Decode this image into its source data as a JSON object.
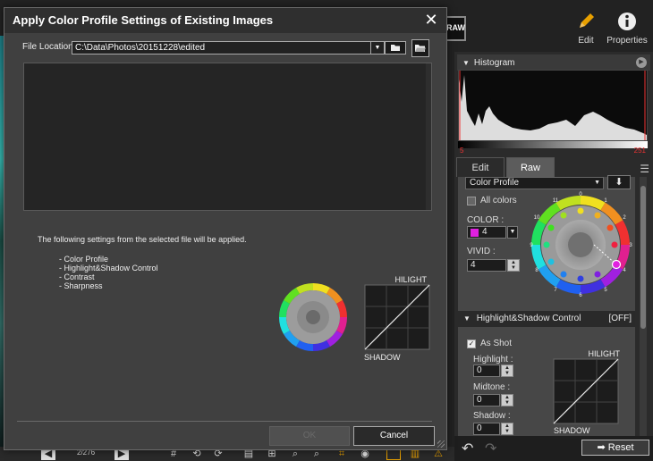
{
  "dialog": {
    "title": "Apply Color Profile Settings of Existing Images",
    "close_icon": "close-icon",
    "file_location_label": "File Location:",
    "file_location_value": "C:\\Data\\Photos\\20151228\\edited",
    "info_text": "The following settings from the selected file will be applied.",
    "settings": [
      "- Color Profile",
      "- Highlight&Shadow Control",
      "- Contrast",
      "- Sharpness"
    ],
    "curve": {
      "hilight": "HILIGHT",
      "shadow": "SHADOW"
    },
    "ok_label": "OK",
    "cancel_label": "Cancel"
  },
  "app": {
    "thumb_label": "RAW",
    "edit_label": "Edit",
    "properties_label": "Properties",
    "histogram_label": "Histogram",
    "histogram_min": "5",
    "histogram_max": "251",
    "tabs": [
      "Edit",
      "Raw"
    ],
    "active_tab": "Raw",
    "color_profile": "Color Profile",
    "all_colors": "All colors",
    "color_label": "COLOR :",
    "color_value": "4",
    "color_swatch": "#e020e0",
    "vivid_label": "VIVID :",
    "vivid_value": "4",
    "wheel_numbers": [
      "0",
      "1",
      "2",
      "3",
      "4",
      "5",
      "6",
      "7",
      "8",
      "9",
      "10",
      "11"
    ],
    "hs_header": "Highlight&Shadow Control",
    "hs_state": "[OFF]",
    "as_shot": "As Shot",
    "highlight_label": "Highlight :",
    "highlight_value": "0",
    "midtone_label": "Midtone :",
    "midtone_value": "0",
    "shadow_label": "Shadow :",
    "shadow_value": "0",
    "hs_hilight": "HILIGHT",
    "hs_shadow": "SHADOW",
    "reset_label": "Reset",
    "page_counter": "2/276"
  },
  "colors": {
    "dialog_bg": "#404040",
    "accent_orange": "#e8a000"
  }
}
